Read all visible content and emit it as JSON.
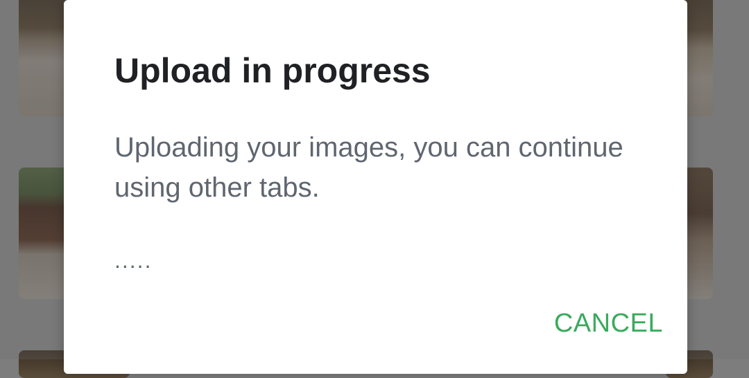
{
  "dialog": {
    "title": "Upload in progress",
    "message": "Uploading your images, you can continue using other tabs.",
    "progress_indicator": ".....",
    "cancel_label": "CANCEL"
  },
  "colors": {
    "accent": "#3aaa5c",
    "title_text": "#202124",
    "body_text": "#5f6670",
    "dialog_background": "#ffffff"
  }
}
